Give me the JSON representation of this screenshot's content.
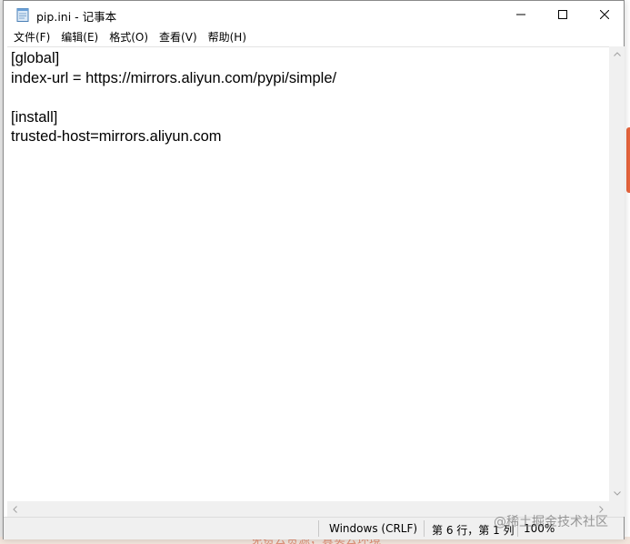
{
  "window": {
    "title": "pip.ini - 记事本",
    "app_icon": "notepad-icon"
  },
  "menu": [
    {
      "label": "文件(F)"
    },
    {
      "label": "编辑(E)"
    },
    {
      "label": "格式(O)"
    },
    {
      "label": "查看(V)"
    },
    {
      "label": "帮助(H)"
    }
  ],
  "editor": {
    "lines": [
      "[global]",
      "index-url = https://mirrors.aliyun.com/pypi/simple/",
      "",
      "[install]",
      "trusted-host=mirrors.aliyun.com"
    ]
  },
  "status": {
    "encoding": "Windows (CRLF)",
    "position": "第 6 行，第 1 列",
    "zoom": "100%"
  },
  "watermark": "@稀土掘金技术社区",
  "background": {
    "bottom_text": "免费云资源，真实云环境"
  }
}
